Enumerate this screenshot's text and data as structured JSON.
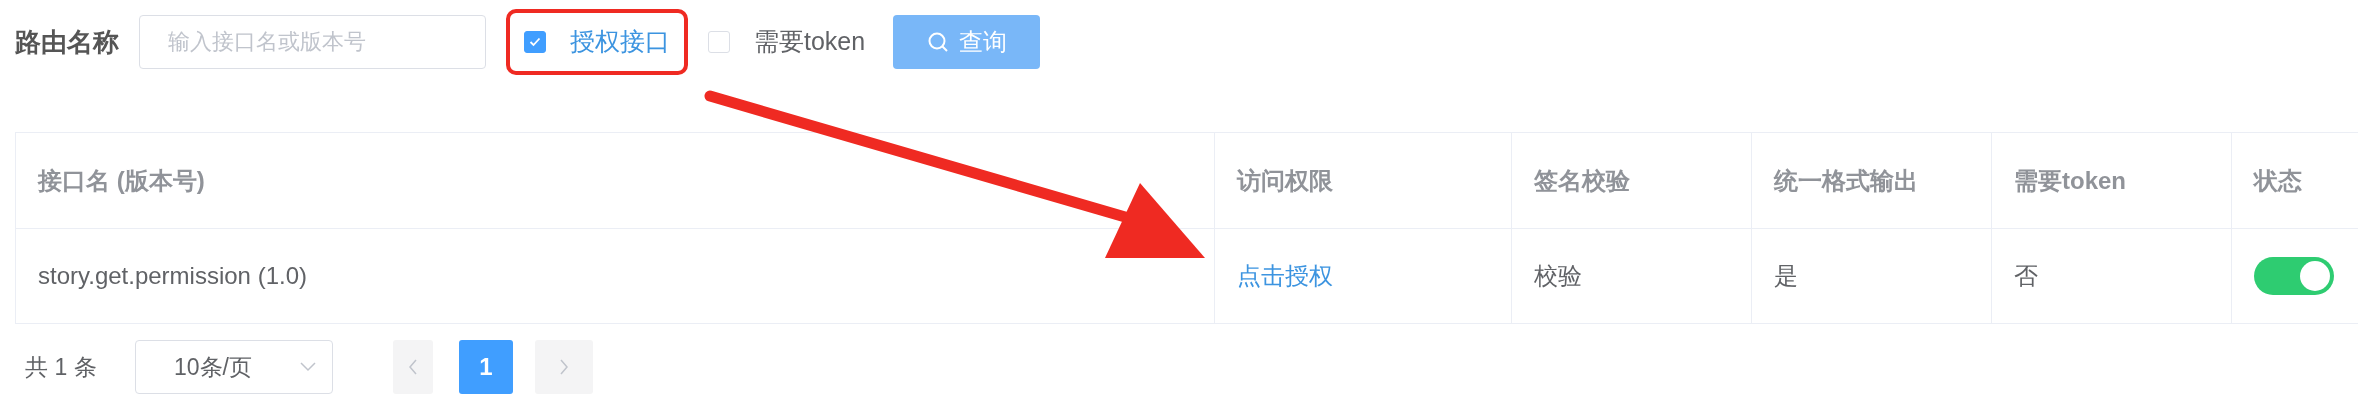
{
  "filter": {
    "label": "路由名称",
    "placeholder": "输入接口名或版本号",
    "checkboxes": [
      {
        "label": "授权接口",
        "checked": true,
        "highlighted": true
      },
      {
        "label": "需要token",
        "checked": false,
        "highlighted": false
      }
    ],
    "button": "查询"
  },
  "arrow": true,
  "table": {
    "columns": [
      "接口名 (版本号)",
      "访问权限",
      "签名校验",
      "统一格式输出",
      "需要token",
      "状态"
    ],
    "rows": [
      {
        "cells": [
          {
            "kind": "text",
            "text": "story.get.permission (1.0)"
          },
          {
            "kind": "link",
            "text": "点击授权"
          },
          {
            "kind": "text",
            "text": "校验"
          },
          {
            "kind": "text",
            "text": "是"
          },
          {
            "kind": "text",
            "text": "否"
          },
          {
            "kind": "switch",
            "on": true
          }
        ]
      }
    ]
  },
  "pagination": {
    "total": "共 1 条",
    "page_size": "10条/页",
    "pages": [
      {
        "label": "1",
        "selected": true
      }
    ]
  }
}
